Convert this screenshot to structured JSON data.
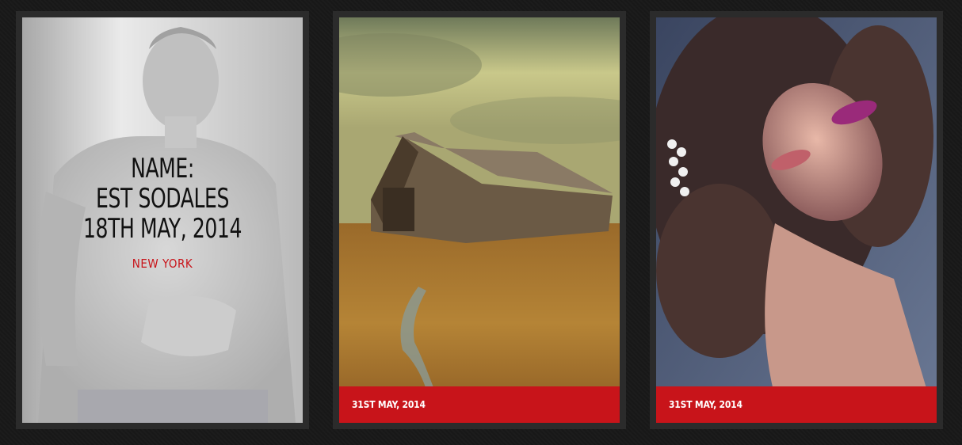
{
  "cards": [
    {
      "name_line": "NAME:",
      "title_line": "EST SODALES",
      "date_line": "18TH MAY, 2014",
      "city": "NEW YORK",
      "photo": "man-portrait-image"
    },
    {
      "date": "31ST MAY, 2014",
      "photo": "old-barn-landscape-image"
    },
    {
      "date": "31ST MAY, 2014",
      "photo": "woman-curly-hair-portrait-image"
    }
  ],
  "colors": {
    "background": "#181818",
    "card_frame": "#2b2b2b",
    "accent_red": "#c8141a",
    "overlay": "#f5f5f5"
  }
}
